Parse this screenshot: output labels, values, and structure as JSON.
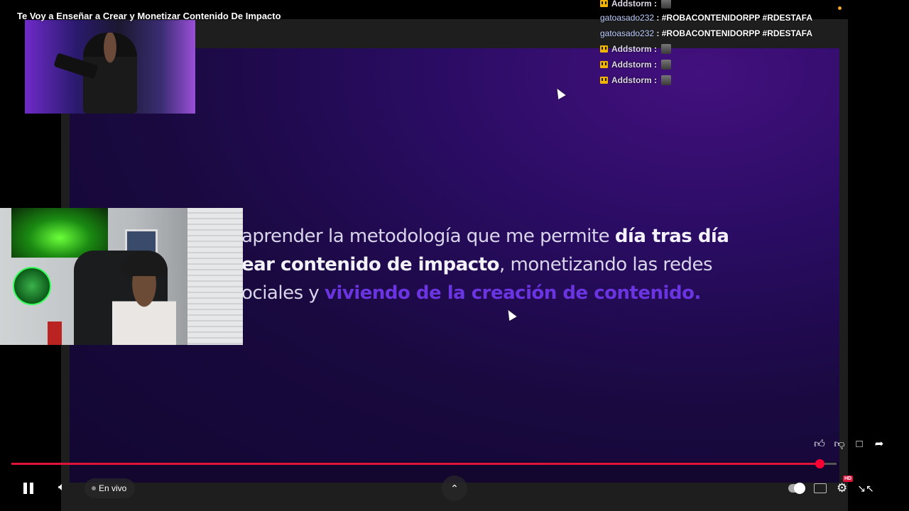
{
  "video": {
    "title": "Te Voy a Enseñar a Crear y Monetizar Contenido De Impacto"
  },
  "slide": {
    "line1_plain": "aprender la metodología que me permite ",
    "line1_bold": "día tras día",
    "line2_bold": "ear contenido de impacto",
    "line2_plain": ", monetizando las redes",
    "line3_plain": "ociales y ",
    "line3_accent": "viviendo de la creación de contenido."
  },
  "chat": {
    "messages": [
      {
        "user": "Addstorm",
        "badge": "crown-icon",
        "text": ""
      },
      {
        "user": "gatoasado232",
        "badge": "",
        "text": "#ROBACONTENIDORPP #RDESTAFA"
      },
      {
        "user": "gatoasado232",
        "badge": "",
        "text": "#ROBACONTENIDORPP #RDESTAFA"
      },
      {
        "user": "Addstorm",
        "badge": "crown-icon",
        "text": ""
      },
      {
        "user": "Addstorm",
        "badge": "crown-icon",
        "text": ""
      },
      {
        "user": "Addstorm",
        "badge": "crown-icon",
        "text": ""
      }
    ],
    "separator": " : "
  },
  "player": {
    "live_label": "En vivo",
    "hd_label": "HD",
    "progress_fraction": 0.979,
    "accent_color": "#ff0033",
    "icons": {
      "pause": "pause-icon",
      "volume": "volume-icon",
      "up": "chevron-up-icon",
      "autoplay": "autoplay-toggle",
      "captions": "captions-icon",
      "settings": "gear-icon",
      "collapse": "collapse-icon",
      "like": "thumbs-up-icon",
      "dislike": "thumbs-down-icon",
      "comment": "comment-icon",
      "share": "share-icon"
    }
  }
}
